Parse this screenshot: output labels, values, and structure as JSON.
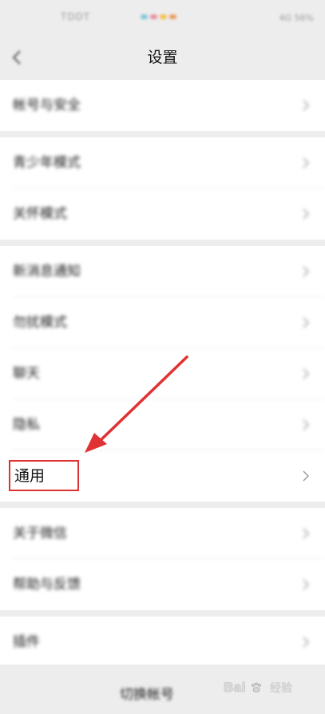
{
  "status_bar": {
    "left_text": "TDDT",
    "right_text": "4G 56%",
    "dot_colors": [
      "#7ec8d8",
      "#e58fa3",
      "#f2c04a",
      "#e99b62"
    ]
  },
  "nav": {
    "title": "设置",
    "back_icon": "chevron-left-icon"
  },
  "settings": {
    "groups": [
      {
        "items": [
          {
            "label": "帐号与安全"
          }
        ]
      },
      {
        "items": [
          {
            "label": "青少年模式"
          },
          {
            "label": "关怀模式"
          }
        ]
      },
      {
        "items": [
          {
            "label": "新消息通知"
          },
          {
            "label": "勿扰模式"
          },
          {
            "label": "聊天"
          },
          {
            "label": "隐私"
          },
          {
            "label": "通用"
          }
        ]
      },
      {
        "items": [
          {
            "label": "关于微信"
          },
          {
            "label": "帮助与反馈"
          }
        ]
      },
      {
        "items": [
          {
            "label": "插件"
          }
        ]
      }
    ],
    "chevron_icon": "chevron-right-icon",
    "highlighted_item": "通用",
    "highlight_color": "#e03232"
  },
  "footer": {
    "switch_account": "切换帐号"
  },
  "watermark": {
    "brand": "Bai",
    "suffix": "经验"
  }
}
